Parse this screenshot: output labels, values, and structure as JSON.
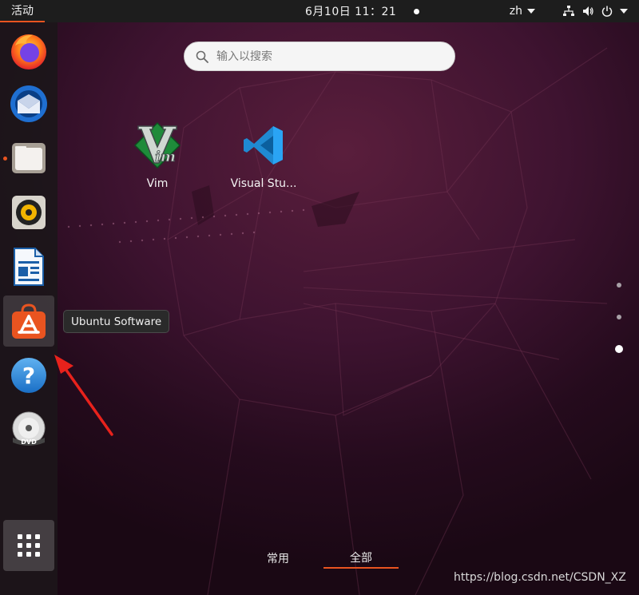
{
  "topbar": {
    "activities_label": "活动",
    "clock": "6月10日 11：21",
    "language": "zh"
  },
  "dock": {
    "items": [
      {
        "name": "firefox",
        "icon": "firefox-icon"
      },
      {
        "name": "thunderbird",
        "icon": "thunderbird-icon"
      },
      {
        "name": "files",
        "icon": "files-icon",
        "running": true
      },
      {
        "name": "rhythmbox",
        "icon": "rhythmbox-icon"
      },
      {
        "name": "libreoffice-writer",
        "icon": "writer-icon"
      },
      {
        "name": "ubuntu-software",
        "icon": "ubuntu-software-icon",
        "hovered": true
      },
      {
        "name": "help",
        "icon": "help-icon"
      },
      {
        "name": "dvd",
        "icon": "dvd-icon"
      }
    ],
    "show_apps_icon": "grid-icon"
  },
  "tooltip": {
    "text": "Ubuntu Software"
  },
  "search": {
    "placeholder": "输入以搜索"
  },
  "apps": [
    {
      "label": "Vim",
      "icon": "vim-icon"
    },
    {
      "label": "Visual Stu...",
      "icon": "vscode-icon"
    }
  ],
  "pagination": {
    "pages": 3,
    "active_index": 2
  },
  "tabs": [
    {
      "label": "常用",
      "active": false
    },
    {
      "label": "全部",
      "active": true
    }
  ],
  "watermark": "https://blog.csdn.net/CSDN_XZ",
  "colors": {
    "accent": "#e95420",
    "topbar": "#1d1d1d",
    "wallpaper": "#3e1330"
  }
}
